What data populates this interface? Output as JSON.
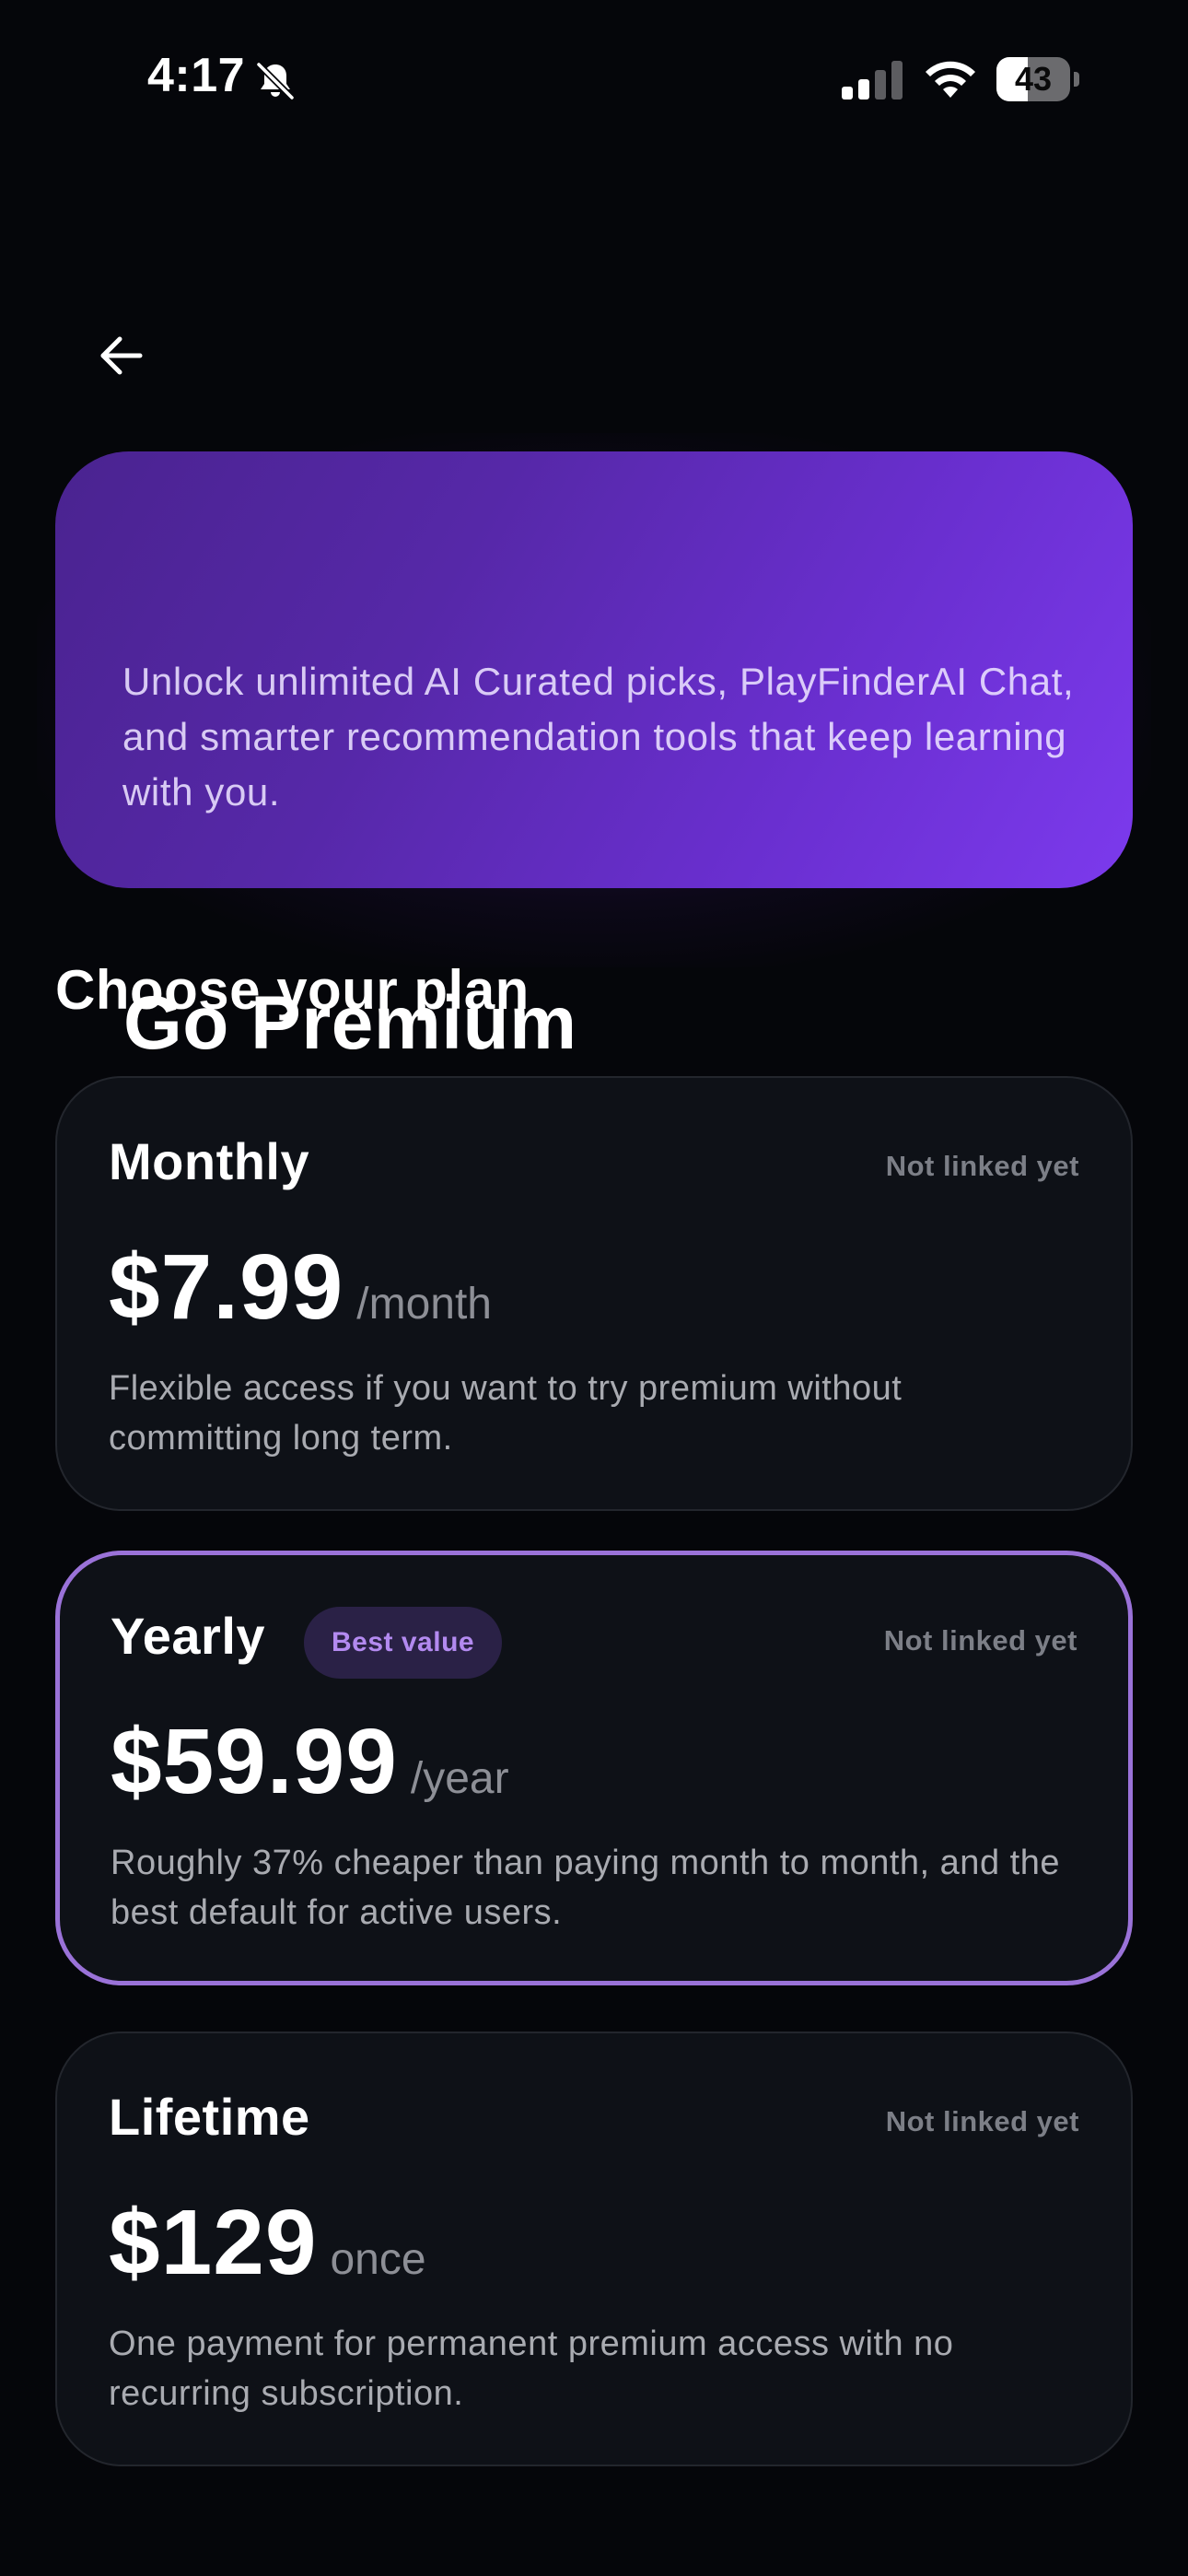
{
  "status_bar": {
    "time": "4:17",
    "battery_level": "43",
    "battery_fraction": 0.43,
    "icons": [
      "bell-slash-icon",
      "signal-icon",
      "wifi-icon",
      "battery-icon"
    ]
  },
  "navigation": {
    "back_icon": "arrow-left-icon"
  },
  "hero": {
    "title": "Go Premium",
    "subtitle": "Unlock unlimited AI Curated picks, PlayFinderAI Chat, and smarter recommendation tools that keep learning with you."
  },
  "plans_section": {
    "heading": "Choose your plan"
  },
  "plans": [
    {
      "name": "Monthly",
      "status": "Not linked yet",
      "price": "$7.99",
      "period": "/month",
      "description": "Flexible access if you want to try premium without committing long term.",
      "selected": false
    },
    {
      "name": "Yearly",
      "badge": "Best value",
      "status": "Not linked yet",
      "price": "$59.99",
      "period": "/year",
      "description": "Roughly 37% cheaper than paying month to month, and the best default for active users.",
      "selected": true
    },
    {
      "name": "Lifetime",
      "status": "Not linked yet",
      "price": "$129",
      "period": "once",
      "description": "One payment for permanent premium access with no recurring subscription.",
      "selected": false
    }
  ],
  "colors": {
    "background": "#05060a",
    "hero_gradient_start": "#4a2390",
    "hero_gradient_end": "#7c3aed",
    "card_background": "#0e1117",
    "selected_border": "#9a72d8",
    "badge_text": "#b38af0",
    "badge_background": "#2a2146"
  }
}
